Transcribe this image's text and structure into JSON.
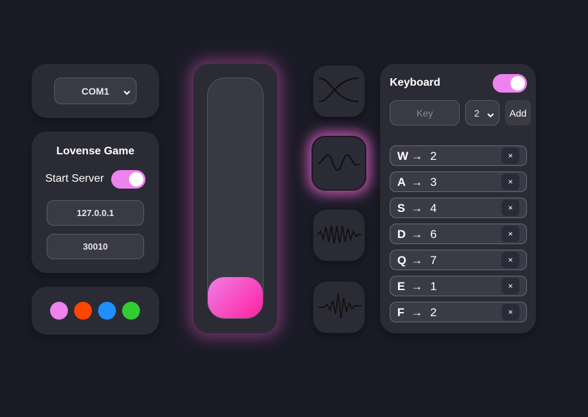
{
  "serial": {
    "port_selected": "COM1"
  },
  "lovense": {
    "title": "Lovense Game",
    "start_server_label": "Start Server",
    "start_server_on": true,
    "ip": "127.0.0.1",
    "port": "30010"
  },
  "palette": [
    {
      "name": "violet-dot",
      "color": "#ee82ee"
    },
    {
      "name": "orange-red-dot",
      "color": "#ff4500"
    },
    {
      "name": "blue-dot",
      "color": "#1e90ff"
    },
    {
      "name": "green-dot",
      "color": "#32cd32"
    }
  ],
  "intensity_slider": {
    "level": 0.0,
    "accent": "#ff4fc0"
  },
  "wave_buttons": [
    {
      "name": "cross-wave-icon",
      "active": false
    },
    {
      "name": "sine-wave-icon",
      "active": true
    },
    {
      "name": "dense-wave-icon",
      "active": false
    },
    {
      "name": "burst-wave-icon",
      "active": false
    }
  ],
  "keyboard": {
    "title": "Keyboard",
    "enabled": true,
    "key_placeholder": "Key",
    "level_selected": "2",
    "add_label": "Add",
    "arrow": "→",
    "remove_label": "×",
    "mappings": [
      {
        "key": "W",
        "value": "2"
      },
      {
        "key": "A",
        "value": "3"
      },
      {
        "key": "S",
        "value": "4"
      },
      {
        "key": "D",
        "value": "6"
      },
      {
        "key": "Q",
        "value": "7"
      },
      {
        "key": "E",
        "value": "1"
      },
      {
        "key": "F",
        "value": "2"
      }
    ]
  }
}
